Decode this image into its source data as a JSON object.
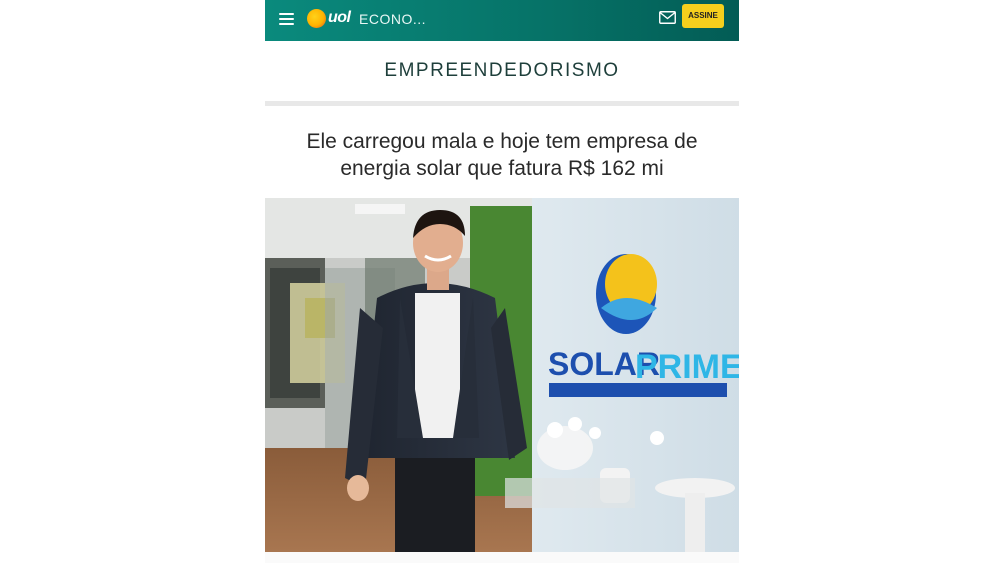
{
  "header": {
    "logo_text": "uol",
    "section_label": "ECONO...",
    "subscribe_label": "ASSINE",
    "icons": [
      "menu-icon",
      "mail-icon"
    ]
  },
  "channel": {
    "title": "EMPREENDEDORISMO"
  },
  "article": {
    "headline": "Ele carregou mala e hoje tem empresa de energia solar que fatura R$ 162 mi",
    "photo": {
      "brand_text_left": "SOLAR",
      "brand_text_right": "PRIME"
    }
  },
  "colors": {
    "header": "#067267",
    "subscribe_button": "#f6cf1d",
    "brand_blue": "#1d55b8",
    "brand_yellow": "#f4c21b"
  }
}
